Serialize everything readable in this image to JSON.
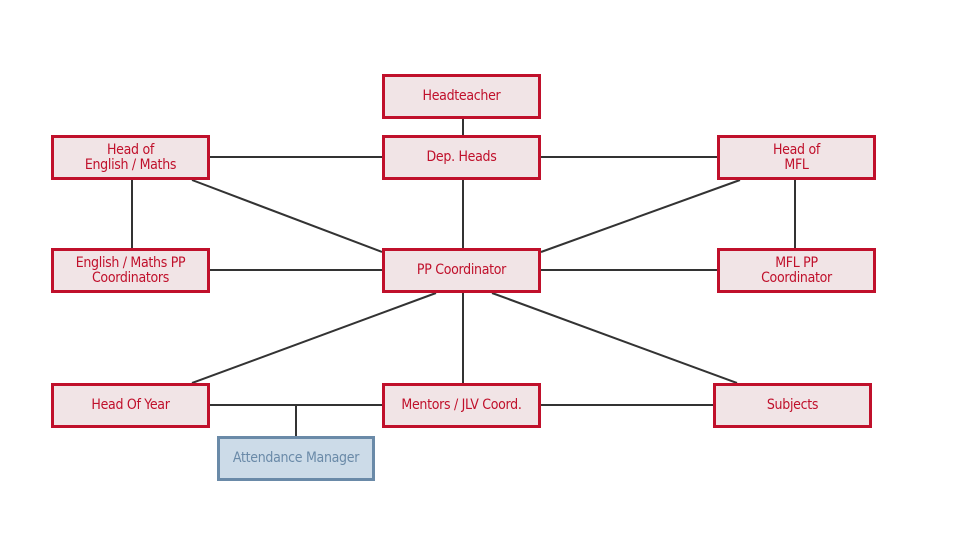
{
  "colors": {
    "accent": "#c0102b",
    "accent_fill": "#f1e4e6",
    "secondary": "#6a8aa8",
    "secondary_fill": "#ccdbe8",
    "connector": "#333333"
  },
  "nodes": [
    {
      "id": "headteacher",
      "label": "Headteacher",
      "style": "red"
    },
    {
      "id": "dep-heads",
      "label": "Dep. Heads",
      "style": "red"
    },
    {
      "id": "head-eng-maths",
      "label": "Head of\nEnglish / Maths",
      "style": "red"
    },
    {
      "id": "head-mfl",
      "label": "Head of\nMFL",
      "style": "red"
    },
    {
      "id": "eng-maths-pp",
      "label": "English / Maths PP\nCoordinators",
      "style": "red"
    },
    {
      "id": "pp-coordinator",
      "label": "PP Coordinator",
      "style": "red"
    },
    {
      "id": "mfl-pp",
      "label": "MFL PP\nCoordinator",
      "style": "red"
    },
    {
      "id": "head-of-year",
      "label": "Head Of Year",
      "style": "red"
    },
    {
      "id": "mentors",
      "label": "Mentors / JLV Coord.",
      "style": "red"
    },
    {
      "id": "subjects",
      "label": "Subjects",
      "style": "red"
    },
    {
      "id": "attendance-manager",
      "label": "Attendance Manager",
      "style": "blue"
    }
  ],
  "edges": [
    [
      "headteacher",
      "dep-heads"
    ],
    [
      "head-eng-maths",
      "dep-heads"
    ],
    [
      "dep-heads",
      "head-mfl"
    ],
    [
      "dep-heads",
      "pp-coordinator"
    ],
    [
      "head-eng-maths",
      "eng-maths-pp"
    ],
    [
      "head-mfl",
      "mfl-pp"
    ],
    [
      "head-eng-maths",
      "pp-coordinator"
    ],
    [
      "head-mfl",
      "pp-coordinator"
    ],
    [
      "eng-maths-pp",
      "pp-coordinator"
    ],
    [
      "pp-coordinator",
      "mfl-pp"
    ],
    [
      "pp-coordinator",
      "head-of-year"
    ],
    [
      "pp-coordinator",
      "mentors"
    ],
    [
      "pp-coordinator",
      "subjects"
    ],
    [
      "head-of-year",
      "mentors"
    ],
    [
      "mentors",
      "subjects"
    ],
    [
      "head-of-year",
      "attendance-manager"
    ]
  ]
}
